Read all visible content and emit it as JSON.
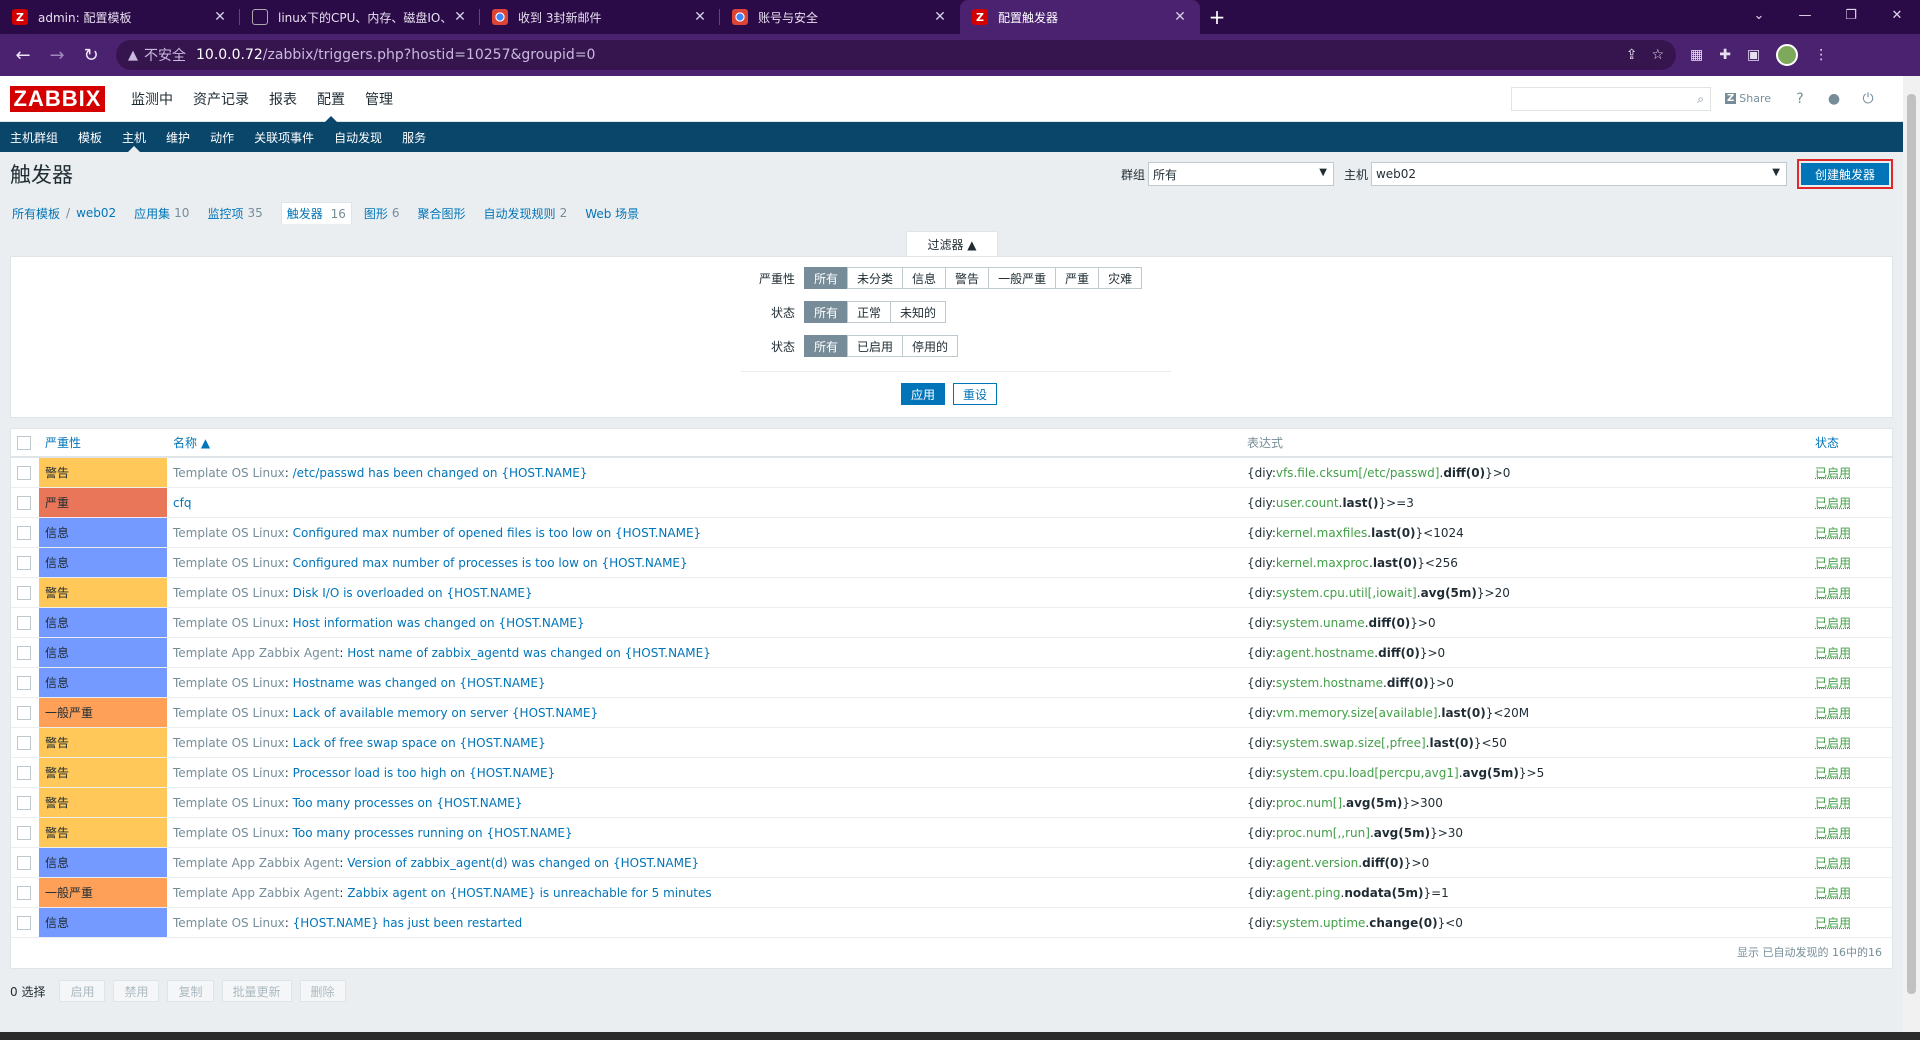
{
  "browser": {
    "tabs": [
      {
        "title": "admin: 配置模板",
        "icon": "zabbix-favicon"
      },
      {
        "title": "linux下的CPU、内存、磁盘IO、",
        "icon": "github-favicon"
      },
      {
        "title": "收到 3封新邮件",
        "icon": "chrome-favicon"
      },
      {
        "title": "账号与安全",
        "icon": "chrome-favicon"
      },
      {
        "title": "配置触发器",
        "icon": "zabbix-favicon"
      }
    ],
    "insecure_label": "不安全",
    "url_host": "10.0.0.72",
    "url_path": "/zabbix/triggers.php?hostid=10257&groupid=0"
  },
  "zabbix": {
    "logo": "ZABBIX",
    "top_menu": [
      "监测中",
      "资产记录",
      "报表",
      "配置",
      "管理"
    ],
    "share_label": "Share",
    "sub_menu": [
      "主机群组",
      "模板",
      "主机",
      "维护",
      "动作",
      "关联项事件",
      "自动发现",
      "服务"
    ]
  },
  "page": {
    "title": "触发器",
    "group_label": "群组",
    "group_value": "所有",
    "host_label": "主机",
    "host_value": "web02",
    "create_button": "创建触发器"
  },
  "host_nav": {
    "all_templates": "所有模板",
    "host": "web02",
    "apps": "应用集",
    "apps_count": "10",
    "items": "监控项",
    "items_count": "35",
    "triggers": "触发器",
    "triggers_count": "16",
    "graphs": "图形",
    "graphs_count": "6",
    "screens": "聚合图形",
    "discovery": "自动发现规则",
    "discovery_count": "2",
    "web": "Web 场景"
  },
  "filter": {
    "tab_label": "过滤器 ▲",
    "severity_label": "严重性",
    "severity_options": [
      "所有",
      "未分类",
      "信息",
      "警告",
      "一般严重",
      "严重",
      "灾难"
    ],
    "state_label": "状态",
    "state_options": [
      "所有",
      "正常",
      "未知的"
    ],
    "status_label": "状态",
    "status_options": [
      "所有",
      "已启用",
      "停用的"
    ],
    "apply": "应用",
    "reset": "重设"
  },
  "table": {
    "headers": {
      "severity": "严重性",
      "name": "名称 ▲",
      "expression": "表达式",
      "status": "状态"
    },
    "rows": [
      {
        "severity": "警告",
        "color": "#ffc859",
        "tpl": "Template OS Linux",
        "name": "/etc/passwd has been changed on {HOST.NAME}",
        "host": "{diy:",
        "key": "vfs.file.cksum[/etc/passwd]",
        "fn": "diff(0)",
        "tail": "}>0",
        "status": "已启用"
      },
      {
        "severity": "严重",
        "color": "#e97659",
        "tpl": "",
        "name": "cfq",
        "host": "{diy:",
        "key": "user.count",
        "fn": "last()",
        "tail": "}>=3",
        "status": "已启用"
      },
      {
        "severity": "信息",
        "color": "#7499ff",
        "tpl": "Template OS Linux",
        "name": "Configured max number of opened files is too low on {HOST.NAME}",
        "host": "{diy:",
        "key": "kernel.maxfiles",
        "fn": "last(0)",
        "tail": "}<1024",
        "status": "已启用"
      },
      {
        "severity": "信息",
        "color": "#7499ff",
        "tpl": "Template OS Linux",
        "name": "Configured max number of processes is too low on {HOST.NAME}",
        "host": "{diy:",
        "key": "kernel.maxproc",
        "fn": "last(0)",
        "tail": "}<256",
        "status": "已启用"
      },
      {
        "severity": "警告",
        "color": "#ffc859",
        "tpl": "Template OS Linux",
        "name": "Disk I/O is overloaded on {HOST.NAME}",
        "host": "{diy:",
        "key": "system.cpu.util[,iowait]",
        "fn": "avg(5m)",
        "tail": "}>20",
        "status": "已启用"
      },
      {
        "severity": "信息",
        "color": "#7499ff",
        "tpl": "Template OS Linux",
        "name": "Host information was changed on {HOST.NAME}",
        "host": "{diy:",
        "key": "system.uname",
        "fn": "diff(0)",
        "tail": "}>0",
        "status": "已启用"
      },
      {
        "severity": "信息",
        "color": "#7499ff",
        "tpl": "Template App Zabbix Agent",
        "name": "Host name of zabbix_agentd was changed on {HOST.NAME}",
        "host": "{diy:",
        "key": "agent.hostname",
        "fn": "diff(0)",
        "tail": "}>0",
        "status": "已启用"
      },
      {
        "severity": "信息",
        "color": "#7499ff",
        "tpl": "Template OS Linux",
        "name": "Hostname was changed on {HOST.NAME}",
        "host": "{diy:",
        "key": "system.hostname",
        "fn": "diff(0)",
        "tail": "}>0",
        "status": "已启用"
      },
      {
        "severity": "一般严重",
        "color": "#ffa059",
        "tpl": "Template OS Linux",
        "name": "Lack of available memory on server {HOST.NAME}",
        "host": "{diy:",
        "key": "vm.memory.size[available]",
        "fn": "last(0)",
        "tail": "}<20M",
        "status": "已启用"
      },
      {
        "severity": "警告",
        "color": "#ffc859",
        "tpl": "Template OS Linux",
        "name": "Lack of free swap space on {HOST.NAME}",
        "host": "{diy:",
        "key": "system.swap.size[,pfree]",
        "fn": "last(0)",
        "tail": "}<50",
        "status": "已启用"
      },
      {
        "severity": "警告",
        "color": "#ffc859",
        "tpl": "Template OS Linux",
        "name": "Processor load is too high on {HOST.NAME}",
        "host": "{diy:",
        "key": "system.cpu.load[percpu,avg1]",
        "fn": "avg(5m)",
        "tail": "}>5",
        "status": "已启用"
      },
      {
        "severity": "警告",
        "color": "#ffc859",
        "tpl": "Template OS Linux",
        "name": "Too many processes on {HOST.NAME}",
        "host": "{diy:",
        "key": "proc.num[]",
        "fn": "avg(5m)",
        "tail": "}>300",
        "status": "已启用"
      },
      {
        "severity": "警告",
        "color": "#ffc859",
        "tpl": "Template OS Linux",
        "name": "Too many processes running on {HOST.NAME}",
        "host": "{diy:",
        "key": "proc.num[,,run]",
        "fn": "avg(5m)",
        "tail": "}>30",
        "status": "已启用"
      },
      {
        "severity": "信息",
        "color": "#7499ff",
        "tpl": "Template App Zabbix Agent",
        "name": "Version of zabbix_agent(d) was changed on {HOST.NAME}",
        "host": "{diy:",
        "key": "agent.version",
        "fn": "diff(0)",
        "tail": "}>0",
        "status": "已启用"
      },
      {
        "severity": "一般严重",
        "color": "#ffa059",
        "tpl": "Template App Zabbix Agent",
        "name": "Zabbix agent on {HOST.NAME} is unreachable for 5 minutes",
        "host": "{diy:",
        "key": "agent.ping",
        "fn": "nodata(5m)",
        "tail": "}=1",
        "status": "已启用"
      },
      {
        "severity": "信息",
        "color": "#7499ff",
        "tpl": "Template OS Linux",
        "name": "{HOST.NAME} has just been restarted",
        "host": "{diy:",
        "key": "system.uptime",
        "fn": "change(0)",
        "tail": "}<0",
        "status": "已启用"
      }
    ],
    "footer": "显示 已自动发现的 16中的16"
  },
  "actions": {
    "selected": "0 选择",
    "buttons": [
      "启用",
      "禁用",
      "复制",
      "批量更新",
      "删除"
    ]
  }
}
